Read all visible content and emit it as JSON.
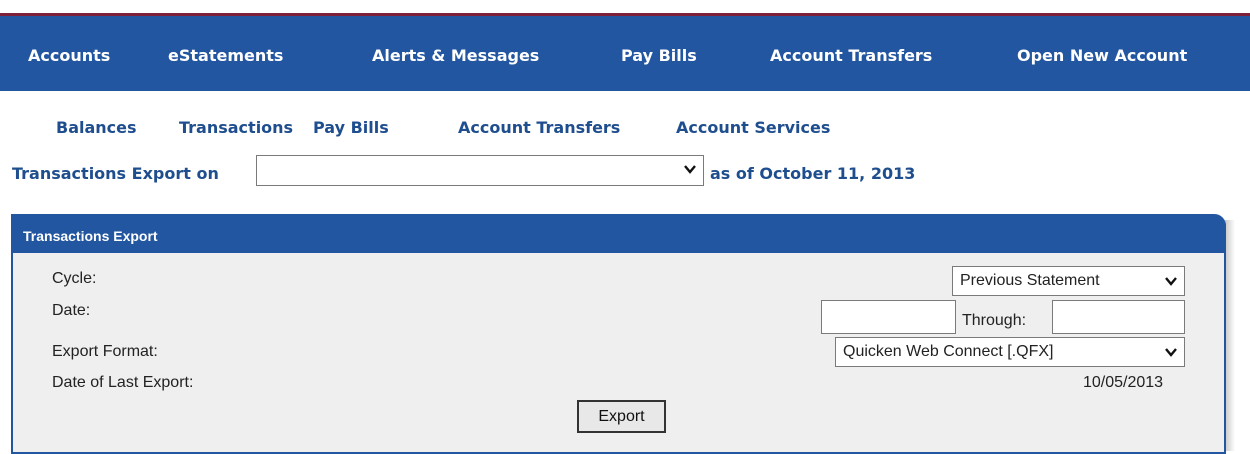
{
  "topnav": {
    "items": [
      "Accounts",
      "eStatements",
      "Alerts & Messages",
      "Pay Bills",
      "Account Transfers",
      "Open New Account"
    ]
  },
  "subnav": {
    "items": [
      "Balances",
      "Transactions",
      "Pay Bills",
      "Account Transfers",
      "Account Services"
    ]
  },
  "export_header": {
    "label": "Transactions Export on",
    "account_value": "",
    "as_of": "as of October 11, 2013"
  },
  "panel": {
    "title": "Transactions Export",
    "cycle_label": "Cycle:",
    "cycle_value": "Previous Statement",
    "date_label": "Date:",
    "date_from": "",
    "through_label": "Through:",
    "date_to": "",
    "format_label": "Export Format:",
    "format_value": "Quicken Web Connect [.QFX]",
    "last_export_label": "Date of Last Export:",
    "last_export_value": "10/05/2013",
    "export_button": "Export"
  },
  "colors": {
    "nav_bg": "#2356a0",
    "link_blue": "#1f4e8f",
    "panel_bg": "#efefef"
  },
  "icons": [
    "chevron-down-icon"
  ]
}
